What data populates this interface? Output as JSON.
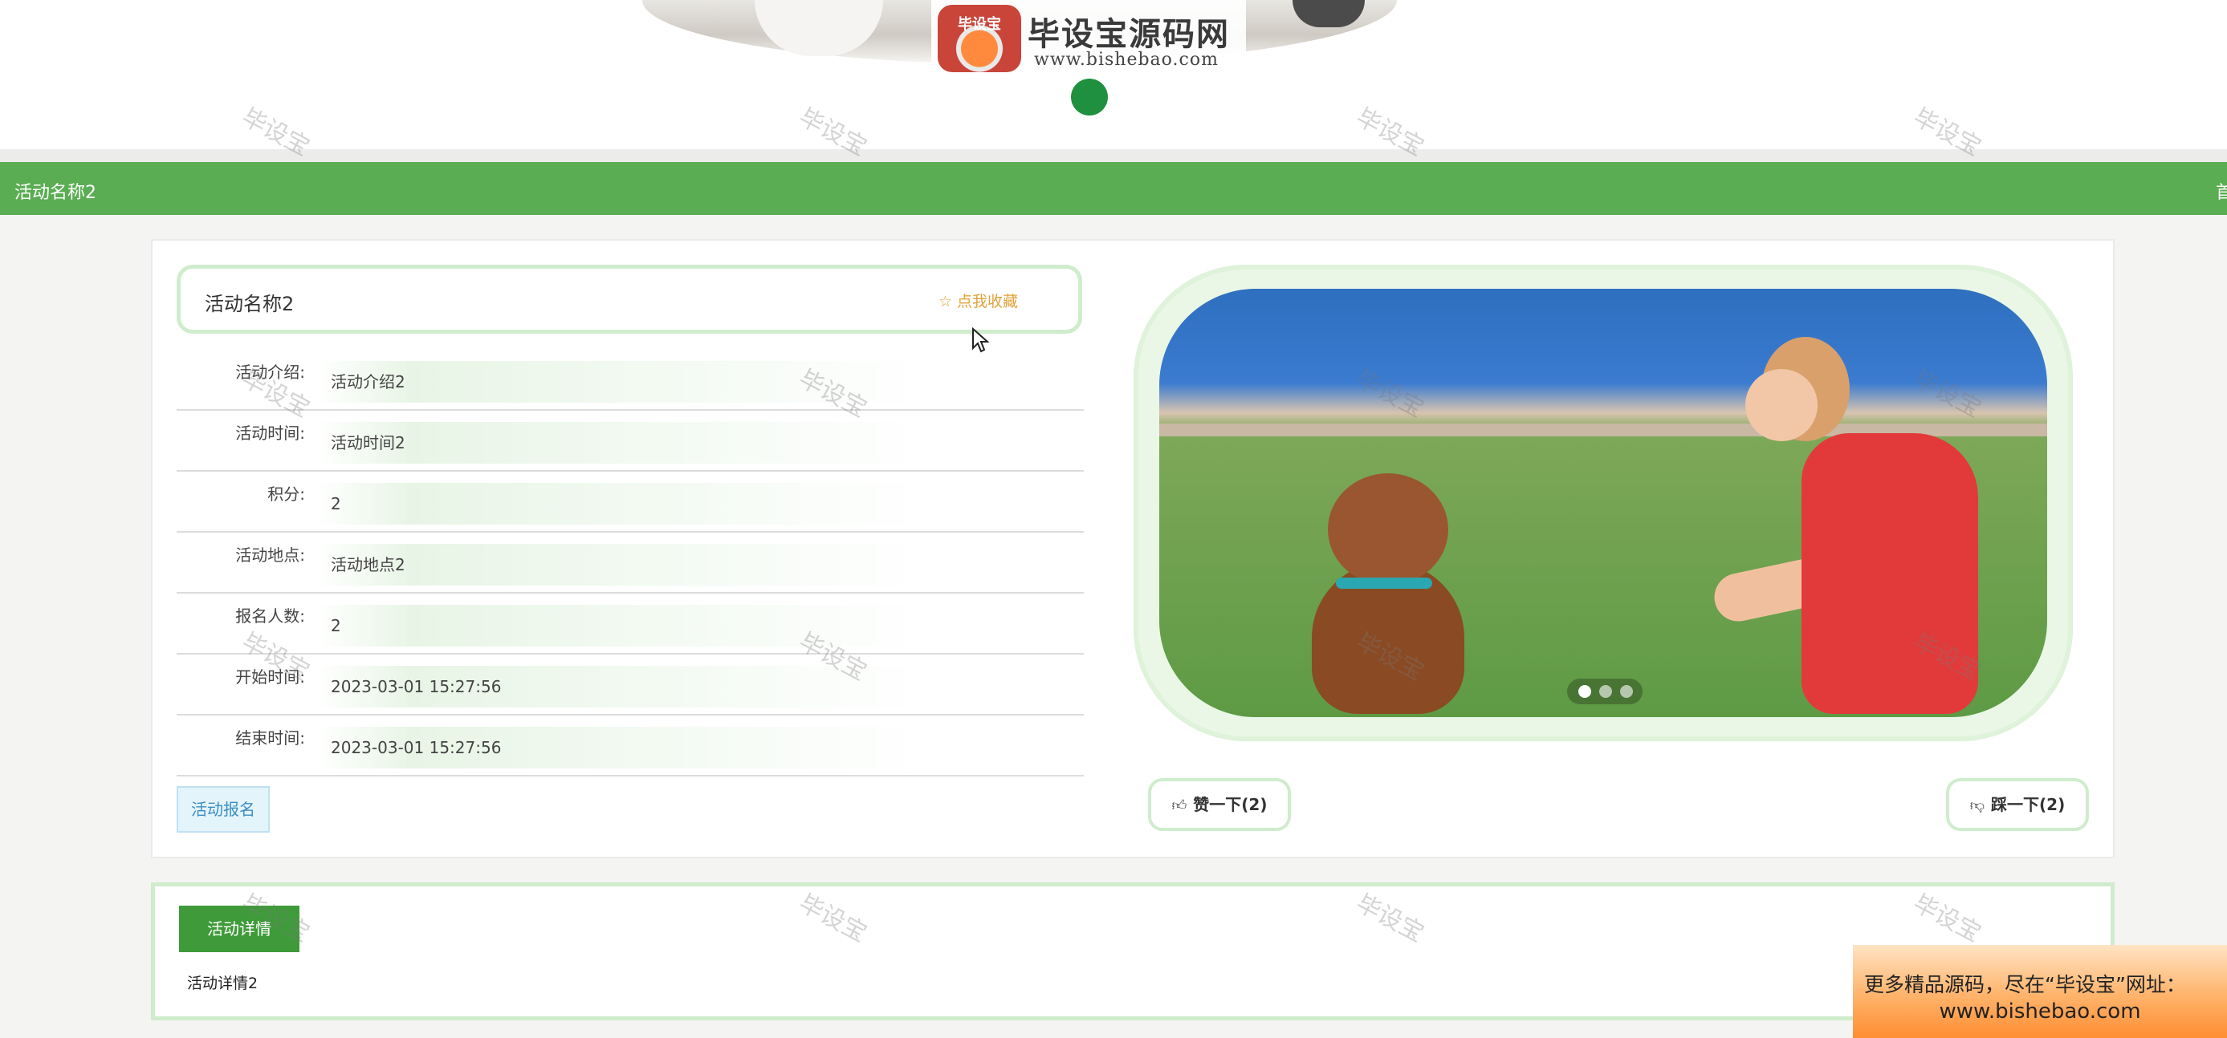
{
  "banner": {
    "logo_badge": "毕设宝",
    "logo_title": "毕设宝源码网",
    "logo_url": "www.bishebao.com"
  },
  "nav": {
    "title": "活动名称2",
    "right_item": "首页"
  },
  "activity": {
    "title": "活动名称2",
    "favorite_icon": "star-icon",
    "favorite_label": "点我收藏",
    "fields": [
      {
        "label": "活动介绍:",
        "value": "活动介绍2"
      },
      {
        "label": "活动时间:",
        "value": "活动时间2"
      },
      {
        "label": "积分:",
        "value": "2"
      },
      {
        "label": "活动地点:",
        "value": "活动地点2"
      },
      {
        "label": "报名人数:",
        "value": "2"
      },
      {
        "label": "开始时间:",
        "value": "2023-03-01 15:27:56"
      },
      {
        "label": "结束时间:",
        "value": "2023-03-01 15:27:56"
      }
    ],
    "signup_label": "活动报名",
    "like_icon": "thumbs-up-icon",
    "like_label": "赞一下(2)",
    "dislike_icon": "thumbs-down-icon",
    "dislike_label": "踩一下(2)",
    "carousel": {
      "count": 3,
      "active": 0
    }
  },
  "details": {
    "tab_label": "活动详情",
    "content": "活动详情2"
  },
  "ad": {
    "line1": "更多精品源码，尽在“毕设宝”网址：",
    "line2": "www.bishebao.com"
  },
  "watermark": "毕设宝",
  "colors": {
    "nav_green": "#5aad52",
    "tab_green": "#3f9b3a",
    "border_green": "#cfeccc",
    "favorite_orange": "#e2a23a",
    "signup_blue": "#3b8fc4"
  }
}
